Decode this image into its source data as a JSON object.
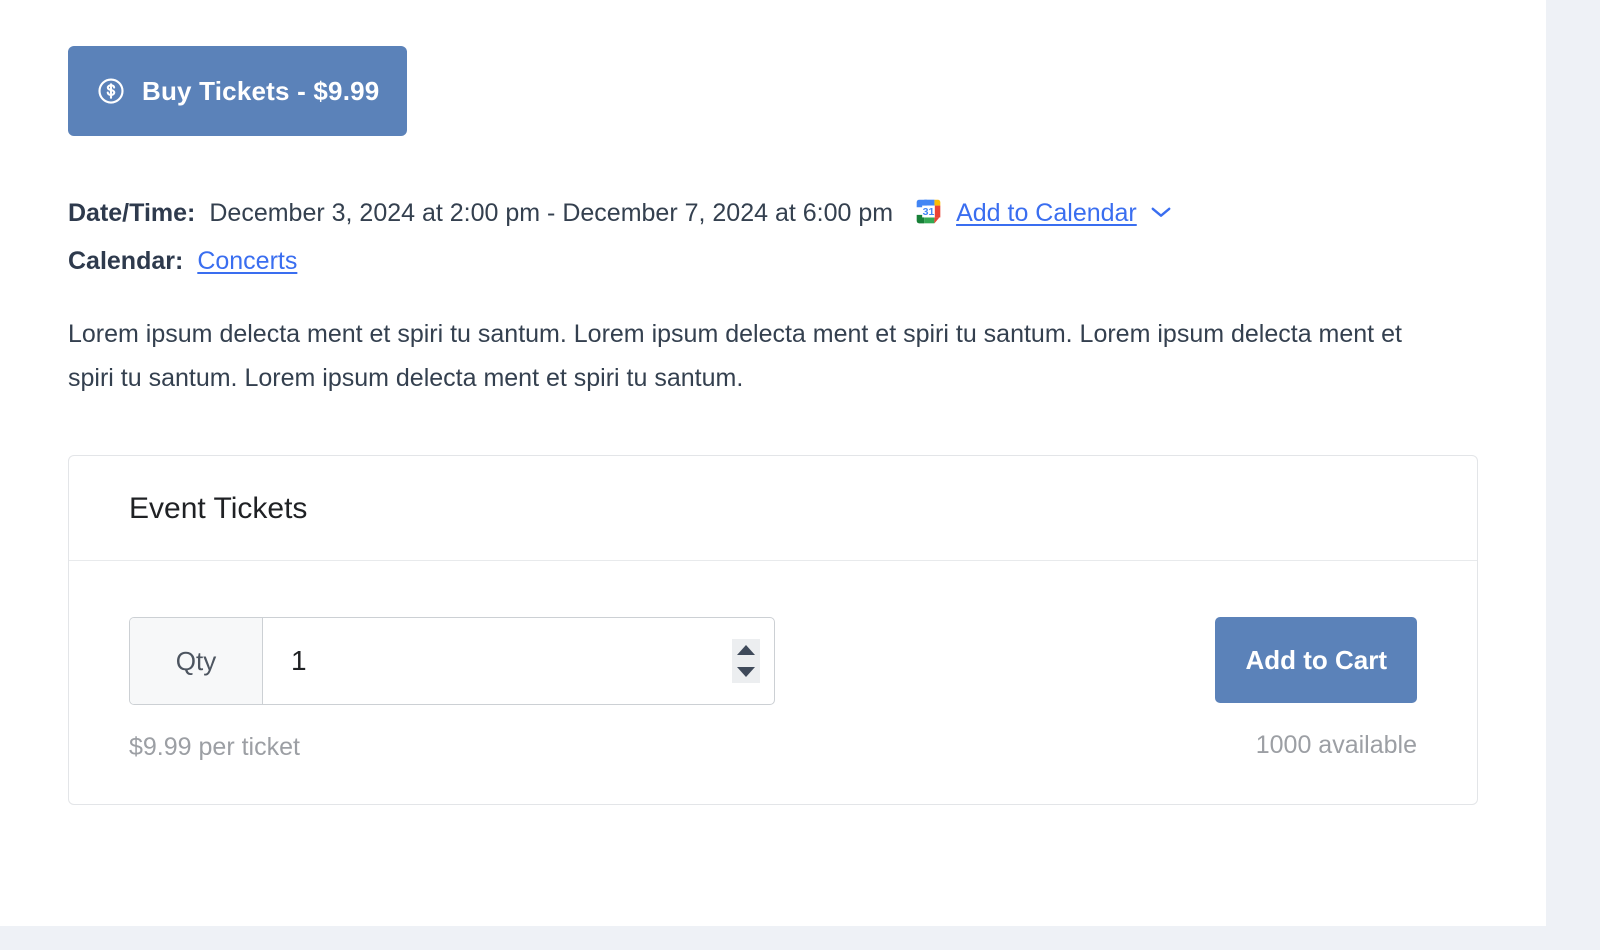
{
  "theme": {
    "accent_blue": "#5b82b9",
    "link_blue": "#3a6ef0",
    "text_dark": "#2e3a4d",
    "text_muted": "#9c9fa4",
    "page_background": "#eef1f6",
    "card_border": "#e3e5e8"
  },
  "buy_button": {
    "label": "Buy Tickets - $9.99",
    "icon": "dollar-circle-icon"
  },
  "event_meta": {
    "datetime_label": "Date/Time:",
    "datetime_value": "December 3, 2024 at 2:00 pm - December 7, 2024 at 6:00 pm",
    "calendar_icon": "google-calendar-icon",
    "calendar_icon_day": "31",
    "add_to_calendar_label": "Add to Calendar",
    "add_to_calendar_chevron": "chevron-down-icon",
    "calendar_label": "Calendar:",
    "calendar_value": "Concerts"
  },
  "description": "Lorem ipsum delecta ment et spiri tu santum. Lorem ipsum delecta ment et spiri tu santum. Lorem ipsum delecta ment et spiri tu santum. Lorem ipsum delecta ment et spiri tu santum.",
  "ticket_card": {
    "title": "Event Tickets",
    "qty_label": "Qty",
    "qty_value": "1",
    "qty_placeholder": "1",
    "price_note": "$9.99 per ticket",
    "add_to_cart_label": "Add to Cart",
    "availability": "1000 available"
  }
}
